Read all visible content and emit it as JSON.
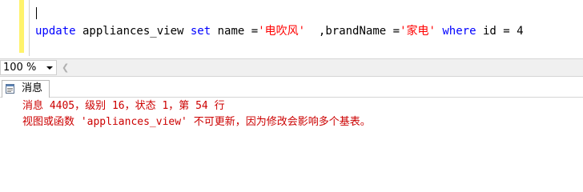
{
  "editor": {
    "sql_kw_update": "update",
    "sql_table": " appliances_view ",
    "sql_kw_set": "set",
    "sql_name_assign": " name =",
    "sql_str_name": "'电吹风'",
    "sql_gap": "  ,brandName =",
    "sql_str_brand": "'家电'",
    "sql_space": " ",
    "sql_kw_where": "where",
    "sql_tail": " id = 4"
  },
  "zoom": {
    "value": "100 %"
  },
  "results": {
    "tab_label": "消息",
    "message_line1": "消息 4405，级别 16，状态 1，第 54 行",
    "message_line2": "视图或函数 'appliances_view' 不可更新，因为修改会影响多个基表。"
  },
  "colors": {
    "keyword": "#0000ff",
    "string": "#ff0000",
    "error": "#cc0000",
    "margin_indicator": "#fff36b"
  }
}
